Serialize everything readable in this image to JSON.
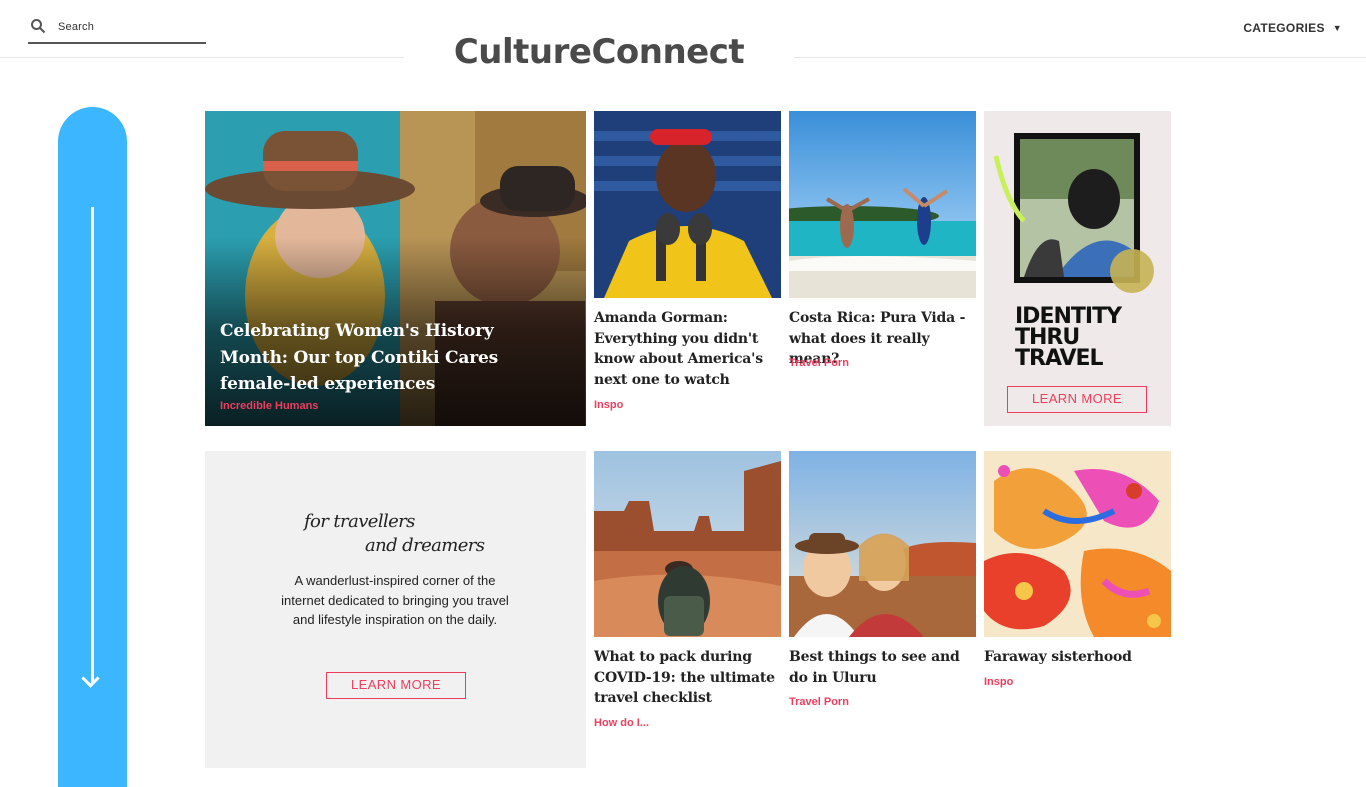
{
  "header": {
    "search_placeholder": "Search",
    "brand": "CultureConnect",
    "categories_label": "CATEGORIES",
    "categories_caret": "▼"
  },
  "featured": {
    "title": "Celebrating Women's History Month: Our top Contiki Cares female-led experiences",
    "tag": "Incredible Humans"
  },
  "articles": [
    {
      "title": "Amanda Gorman: Everything you didn't know about America's next one to watch",
      "tag": "Inspo"
    },
    {
      "title": "Costa Rica: Pura Vida - what does it really mean?",
      "tag": "Travel Porn"
    },
    {
      "title": "What to pack during COVID-19: the ultimate travel checklist",
      "tag": "How do I..."
    },
    {
      "title": "Best things to see and do in Uluru",
      "tag": "Travel Porn"
    },
    {
      "title": "Faraway sisterhood",
      "tag": "Inspo"
    }
  ],
  "identity_promo": {
    "line1": "IDENTITY",
    "line2": "THRU",
    "line3": "TRAVEL",
    "button": "LEARN MORE"
  },
  "about_promo": {
    "tagline_1": "for travellers",
    "tagline_2": "and dreamers",
    "blurb": "A wanderlust-inspired corner of the internet dedicated to bringing you travel and lifestyle inspiration on the daily.",
    "button": "LEARN MORE"
  },
  "colors": {
    "accent": "#ef3d5e",
    "scroll_indicator": "#3cb6ff"
  }
}
